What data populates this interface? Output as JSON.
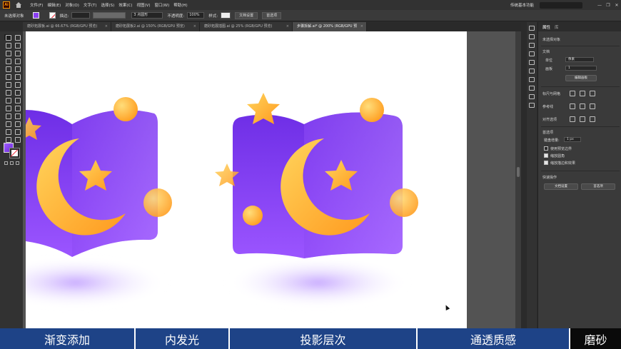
{
  "menubar": {
    "logo": "Ai",
    "items": [
      "文件(F)",
      "编辑(E)",
      "对象(O)",
      "文字(T)",
      "选择(S)",
      "效果(C)",
      "视图(V)",
      "窗口(W)",
      "帮助(H)"
    ],
    "workspace": "传统基本功能",
    "search_placeholder": "",
    "window_buttons": [
      "—",
      "❐",
      "✕"
    ]
  },
  "controlbar": {
    "no_selection": "未选择对象",
    "stroke_label": "描边:",
    "brush": "3 点圆形",
    "opacity_label": "不透明度:",
    "opacity_value": "100%",
    "style_label": "样式:",
    "doc_setup": "文档设置",
    "preferences": "首选项"
  },
  "tabs": [
    {
      "label": "磨砂拓展板.ai @ 66.67% (RGB/GPU 预览)",
      "active": false
    },
    {
      "label": "磨砂拓展板2.ai @ 150% (RGB/GPU 预览)",
      "active": false
    },
    {
      "label": "磨砂拓展插图.ai @ 25% (RGB/GPU 预览)",
      "active": false
    },
    {
      "label": "步骤拆解.ai* @ 200% (RGB/GPU 预览)",
      "active": true
    }
  ],
  "properties": {
    "tabs": [
      "属性",
      "库"
    ],
    "no_selection": "未选择对象",
    "document_title": "文档",
    "units_label": "单位",
    "units_value": "像素",
    "artboard_label": "画板",
    "artboard_value": "1",
    "edit_artboard": "编辑画板",
    "rulers_grids": "标尺与网格",
    "guides": "参考线",
    "snap_options": "对齐选项",
    "preferences_title": "首选项",
    "keyboard_increment_label": "键盘增量:",
    "keyboard_increment_value": "1 px",
    "checks": [
      {
        "label": "使用预览边界",
        "checked": false
      },
      {
        "label": "缩放圆角",
        "checked": true
      },
      {
        "label": "缩放描边和效果",
        "checked": true
      }
    ],
    "quick_actions": "快速操作",
    "doc_setup_btn": "文档设置",
    "prefs_btn": "首选项"
  },
  "subtitles": [
    "渐变添加",
    "内发光",
    "投影层次",
    "通透质感",
    "磨砂"
  ],
  "colors": {
    "book_purple": "#8a3ef2",
    "moon_orange": "#ffb52e",
    "subtitle_bar": "#1e4387"
  }
}
